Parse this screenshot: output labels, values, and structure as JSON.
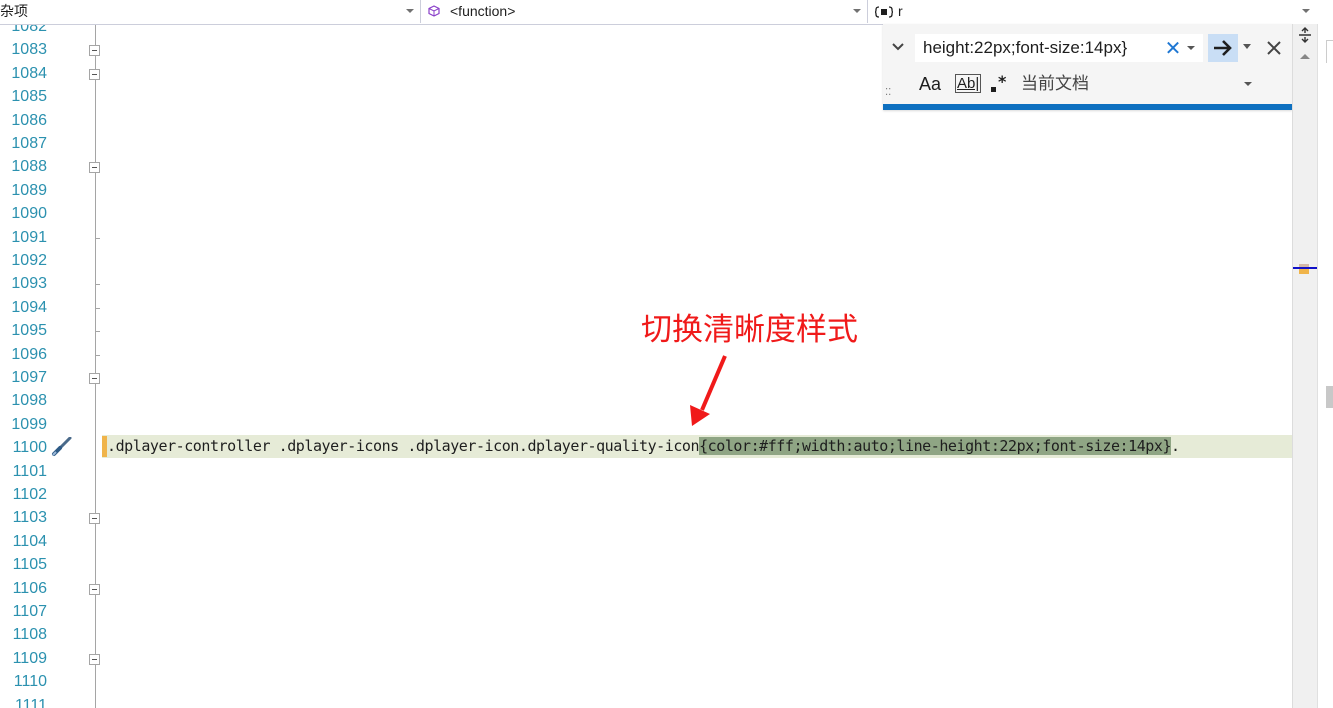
{
  "navigation": {
    "project_combo": "杂项",
    "member_combo": "<function>",
    "scope_combo": "r"
  },
  "line_numbers": [
    "1082",
    "1083",
    "1084",
    "1085",
    "1086",
    "1087",
    "1088",
    "1089",
    "1090",
    "1091",
    "1092",
    "1093",
    "1094",
    "1095",
    "1096",
    "1097",
    "1098",
    "1099",
    "1100",
    "1101",
    "1102",
    "1103",
    "1104",
    "1105",
    "1106",
    "1107",
    "1108",
    "1109",
    "1110",
    "1111"
  ],
  "code": {
    "line_number": "1100",
    "prefix": ".dplayer-controller .dplayer-icons .dplayer-icon.dplayer-quality-icon",
    "match": "{color:#fff;width:auto;line-height:22px;font-size:14px}",
    "suffix": "."
  },
  "annotation": {
    "text": "切换清晰度样式",
    "color": "#f01a1a"
  },
  "find_widget": {
    "search_value": "height:22px;font-size:14px}",
    "match_case_label": "Aa",
    "whole_word_label": "Ab|",
    "scope_label": "当前文档"
  },
  "colors": {
    "line_number": "#2b91af",
    "find_accent": "#0e70c0",
    "current_line_bg": "#e6ebd7",
    "match_bg": "#8fa584"
  }
}
